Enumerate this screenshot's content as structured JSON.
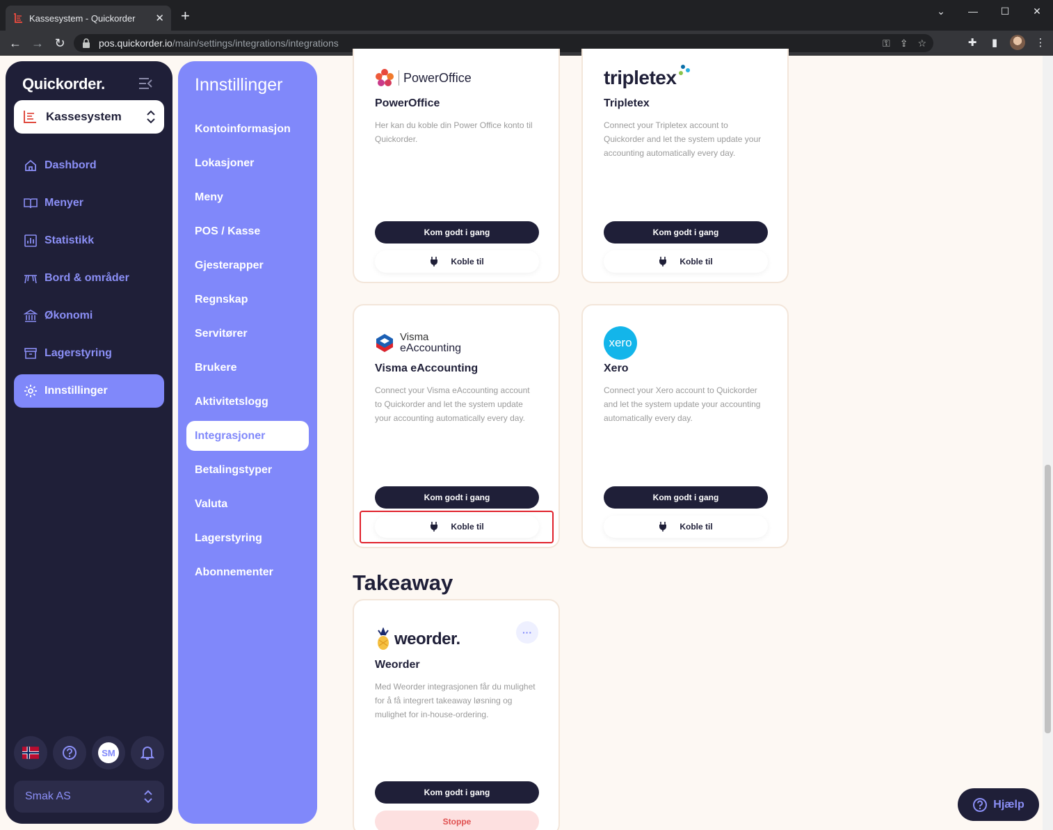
{
  "browser": {
    "tab_title": "Kassesystem - Quickorder",
    "url_host": "pos.quickorder.io",
    "url_path": "/main/settings/integrations/integrations"
  },
  "left_nav": {
    "brand": "Quickorder.",
    "app_select": "Kassesystem",
    "items": [
      {
        "label": "Dashbord",
        "icon": "home-icon"
      },
      {
        "label": "Menyer",
        "icon": "book-icon"
      },
      {
        "label": "Statistikk",
        "icon": "chart-icon"
      },
      {
        "label": "Bord & områder",
        "icon": "table-icon"
      },
      {
        "label": "Økonomi",
        "icon": "bank-icon"
      },
      {
        "label": "Lagerstyring",
        "icon": "archive-icon"
      },
      {
        "label": "Innstillinger",
        "icon": "gear-icon",
        "active": true
      }
    ],
    "user_initials": "SM",
    "company": "Smak AS"
  },
  "settings_nav": {
    "title": "Innstillinger",
    "items": [
      "Kontoinformasjon",
      "Lokasjoner",
      "Meny",
      "POS / Kasse",
      "Gjesterapper",
      "Regnskap",
      "Servitører",
      "Brukere",
      "Aktivitetslogg",
      "Integrasjoner",
      "Betalingstyper",
      "Valuta",
      "Lagerstyring",
      "Abonnementer"
    ],
    "active": "Integrasjoner"
  },
  "cards": {
    "poweroffice": {
      "logo_text": "PowerOffice",
      "title": "PowerOffice",
      "desc": "Her kan du koble din Power Office konto til Quickorder.",
      "primary": "Kom godt i gang",
      "secondary": "Koble til"
    },
    "tripletex": {
      "logo_text": "tripletex",
      "title": "Tripletex",
      "desc": "Connect your Tripletex account to Quickorder and let the system update your accounting automatically every day.",
      "primary": "Kom godt i gang",
      "secondary": "Koble til"
    },
    "visma": {
      "logo_line1": "Visma",
      "logo_line2": "eAccounting",
      "title": "Visma eAccounting",
      "desc": "Connect your Visma eAccounting account to Quickorder and let the system update your accounting automatically every day.",
      "primary": "Kom godt i gang",
      "secondary": "Koble til"
    },
    "xero": {
      "logo_text": "xero",
      "title": "Xero",
      "desc": "Connect your Xero account to Quickorder and let the system update your accounting automatically every day.",
      "primary": "Kom godt i gang",
      "secondary": "Koble til"
    },
    "weorder": {
      "logo_text": "weorder.",
      "title": "Weorder",
      "desc": "Med Weorder integrasjonen får du mulighet for å få integrert takeaway løsning og mulighet for in-house-ordering.",
      "primary": "Kom godt i gang",
      "stop": "Stoppe",
      "more": "···"
    }
  },
  "sections": {
    "takeaway": "Takeaway"
  },
  "help": "Hjælp",
  "colors": {
    "dark": "#1f1f38",
    "accent": "#8088fa",
    "highlight": "#e0202a"
  }
}
